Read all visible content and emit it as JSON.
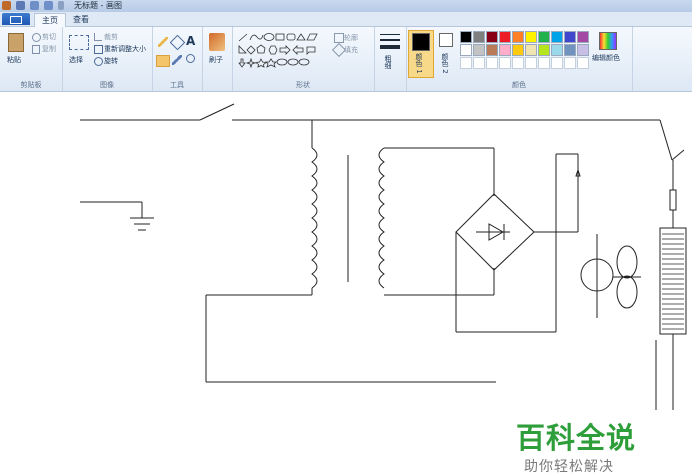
{
  "window": {
    "title": "无标题 - 画图"
  },
  "tabs": [
    {
      "label": "主页",
      "active": true
    },
    {
      "label": "查看",
      "active": false
    }
  ],
  "ribbon": {
    "clipboard": {
      "paste": "粘贴",
      "cut": "剪切",
      "copy": "复制",
      "label": "剪贴板"
    },
    "image": {
      "select": "选择",
      "crop": "裁剪",
      "resize": "重新调整大小",
      "rotate": "旋转",
      "label": "图像"
    },
    "tools": {
      "label": "工具"
    },
    "brushes": {
      "label": "刷子"
    },
    "shapes": {
      "outline": "轮廓",
      "fill": "填充",
      "label": "形状"
    },
    "size": {
      "label": "粗细"
    },
    "colors": {
      "color1": "颜色 1",
      "color2": "颜色 2",
      "edit": "编辑颜色",
      "label": "颜色",
      "palette_row1": [
        "#000000",
        "#7f7f7f",
        "#880015",
        "#ed1c24",
        "#ff7f27",
        "#fff200",
        "#22b14c",
        "#00a2e8",
        "#3f48cc",
        "#a349a4"
      ],
      "palette_row2": [
        "#ffffff",
        "#c3c3c3",
        "#b97a57",
        "#ffaec9",
        "#ffc90e",
        "#efe4b0",
        "#b5e61d",
        "#99d9ea",
        "#7092be",
        "#c8bfe7"
      ]
    }
  },
  "watermark": {
    "title": "百科全说",
    "subtitle": "助你轻松解决"
  }
}
